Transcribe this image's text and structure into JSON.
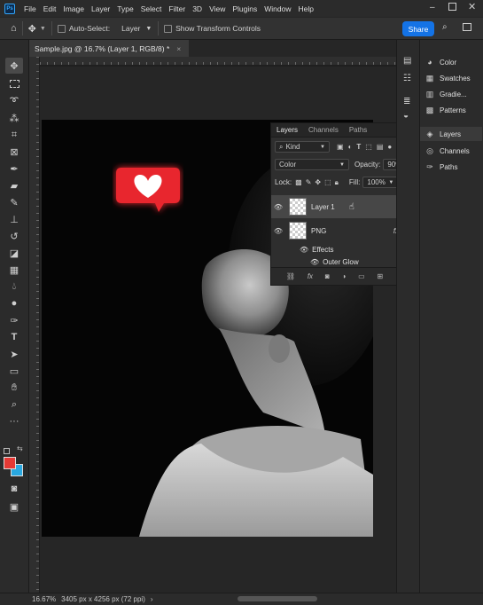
{
  "app": {
    "logo_text": "Ps"
  },
  "menu": [
    "File",
    "Edit",
    "Image",
    "Layer",
    "Type",
    "Select",
    "Filter",
    "3D",
    "View",
    "Plugins",
    "Window",
    "Help"
  ],
  "options_bar": {
    "auto_select_label": "Auto-Select:",
    "auto_select_target": "Layer",
    "transform_label": "Show Transform Controls",
    "share_label": "Share"
  },
  "document": {
    "tab_title": "Sample.jpg @ 16.7% (Layer 1, RGB/8) *",
    "close_glyph": "×"
  },
  "layers_panel": {
    "tabs": [
      "Layers",
      "Channels",
      "Paths"
    ],
    "filter_kind": "Kind",
    "blend_mode": "Color",
    "opacity_label": "Opacity:",
    "opacity_value": "90%",
    "lock_label": "Lock:",
    "fill_label": "Fill:",
    "fill_value": "100%",
    "layers": [
      {
        "name": "Layer 1",
        "selected": true
      },
      {
        "name": "PNG",
        "selected": false,
        "fx": "fx"
      }
    ],
    "effects_label": "Effects",
    "effect_name": "Outer Glow"
  },
  "right_panels": {
    "group1": [
      "Color",
      "Swatches",
      "Gradie...",
      "Patterns"
    ],
    "group2": [
      "Layers",
      "Channels",
      "Paths"
    ]
  },
  "status": {
    "zoom": "16.67%",
    "dimensions": "3405 px x 4256 px (72 ppi)"
  },
  "colors": {
    "foreground": "#e53935",
    "background": "#29a8e0",
    "accent": "#1473e6",
    "heart_badge": "#e8262d"
  },
  "icons": [
    "move-icon",
    "marquee-icon",
    "lasso-icon",
    "magic-wand-icon",
    "crop-icon",
    "frame-icon",
    "eyedropper-icon",
    "healing-icon",
    "brush-icon",
    "stamp-icon",
    "history-brush-icon",
    "eraser-icon",
    "gradient-icon",
    "blur-icon",
    "dodge-icon",
    "pen-icon",
    "type-icon",
    "path-select-icon",
    "rectangle-icon",
    "hand-icon",
    "zoom-icon",
    "more-tools-icon"
  ]
}
